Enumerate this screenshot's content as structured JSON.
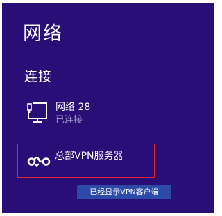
{
  "panel": {
    "title": "网络",
    "section_label": "连接",
    "network": {
      "icon": "wired-network-icon",
      "name": "网络",
      "number": "28",
      "status": "已连接"
    },
    "vpn": {
      "icon": "vpn-link-icon",
      "name": "总部VPN服务器"
    }
  },
  "annotation": {
    "caption": "已经显示VPN客户端",
    "highlight_color": "#e0262b"
  },
  "colors": {
    "panel_background": "#2a0e78",
    "secondary_text": "#9a92c4",
    "caption_background": "#2d4aa8"
  }
}
